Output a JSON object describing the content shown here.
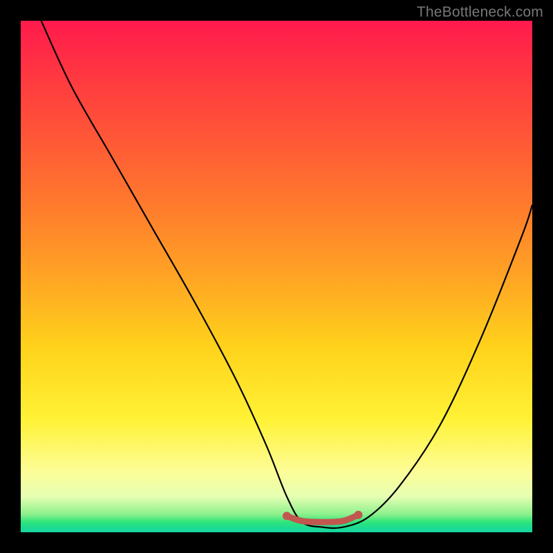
{
  "watermark": "TheBottleneck.com",
  "chart_data": {
    "type": "line",
    "title": "",
    "xlabel": "",
    "ylabel": "",
    "xlim": [
      0,
      100
    ],
    "ylim": [
      0,
      100
    ],
    "series": [
      {
        "name": "bottleneck-curve",
        "x": [
          4,
          10,
          18,
          26,
          34,
          42,
          48,
          52,
          55,
          59,
          63,
          68,
          74,
          82,
          90,
          98,
          100
        ],
        "y": [
          100,
          87,
          73,
          59,
          45,
          30,
          17,
          7,
          2,
          1,
          1,
          3,
          9,
          21,
          38,
          58,
          64
        ]
      },
      {
        "name": "flat-minimum-marker",
        "x": [
          52,
          55,
          59,
          63,
          66
        ],
        "y": [
          3.2,
          2.2,
          2.0,
          2.2,
          3.4
        ]
      }
    ],
    "annotations": []
  },
  "colors": {
    "curve": "#000000",
    "marker": "#c1574f",
    "background_top": "#ff1a4d",
    "background_bottom": "#14d6a2",
    "frame": "#000000"
  }
}
